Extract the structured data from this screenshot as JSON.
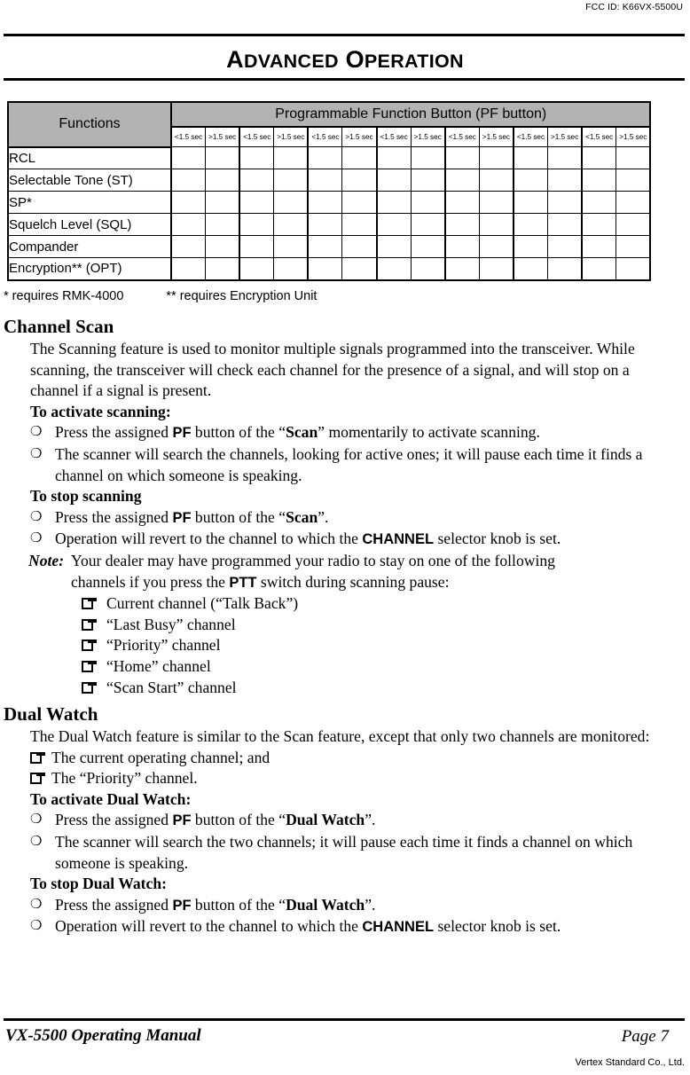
{
  "header": {
    "fcc_id": "FCC ID: K66VX-5500U"
  },
  "chapter": {
    "title_word1_cap": "A",
    "title_word1_rest": "DVANCED",
    "title_word2_cap": "O",
    "title_word2_rest": "PERATION",
    "title_plain": "ADVANCED OPERATION"
  },
  "table": {
    "col_functions_header": "Functions",
    "col_pf_header": "Programmable Function Button (PF button)",
    "sec_short": "<1.5 sec",
    "sec_long": ">1.5 sec",
    "pair_count": 7,
    "sub_headers": [
      "<1.5 sec",
      ">1.5 sec",
      "<1.5 sec",
      ">1.5 sec",
      "<1.5 sec",
      ">1.5 sec",
      "<1.5 sec",
      ">1.5 sec",
      "<1.5 sec",
      ">1.5 sec",
      "<1.5 sec",
      ">1.5 sec",
      "<1.5 sec",
      ">1.5 sec"
    ],
    "rows": [
      {
        "label": "RCL"
      },
      {
        "label": "Selectable Tone (ST)"
      },
      {
        "label": "SP*"
      },
      {
        "label": "Squelch Level (SQL)"
      },
      {
        "label": "Compander"
      },
      {
        "label": "Encryption** (OPT)"
      }
    ],
    "header_fill": "#b3b3b3"
  },
  "footnotes": {
    "note1": "* requires RMK-4000",
    "note2": "** requires Encryption Unit"
  },
  "channel_scan": {
    "heading": "Channel Scan",
    "intro": "The Scanning feature is used to monitor multiple signals programmed into the transceiver. While scanning, the transceiver will check each channel for the presence of a signal, and will stop on a channel if a signal is present.",
    "activate_heading": "To activate scanning:",
    "activate_b1_pre": "Press the assigned ",
    "activate_b1_pf": "PF",
    "activate_b1_mid": " button of the “",
    "activate_b1_scan": "Scan",
    "activate_b1_post": "” momentarily to activate scanning.",
    "activate_b2": "The scanner will search the channels, looking for active ones; it will pause each time it finds a channel on which someone is speaking.",
    "stop_heading": "To stop scanning",
    "stop_b1_pre": "Press the assigned ",
    "stop_b1_pf": "PF",
    "stop_b1_mid": " button of the “",
    "stop_b1_scan": "Scan",
    "stop_b1_post": "”.",
    "stop_b2_pre": "Operation will revert to the channel to which the ",
    "stop_b2_channel": "CHANNEL",
    "stop_b2_post": " selector knob is set.",
    "note_label": "Note:",
    "note_line1": "Your dealer may have programmed your radio to stay on one of the following",
    "note_line2_pre": "channels if you press the ",
    "note_line2_ptt": "PTT",
    "note_line2_post": " switch during scanning pause:",
    "note_items": [
      "Current channel (“Talk Back”)",
      "“Last Busy” channel",
      "“Priority” channel",
      "“Home” channel",
      "“Scan Start” channel"
    ]
  },
  "dual_watch": {
    "heading": "Dual Watch",
    "intro": "The Dual Watch feature is similar to the Scan feature, except that only two channels are monitored:",
    "items": [
      "The current operating channel; and",
      "The “Priority” channel."
    ],
    "activate_heading": "To activate Dual Watch:",
    "activate_b1_pre": "Press the assigned ",
    "activate_b1_pf": "PF",
    "activate_b1_mid": " button of the “",
    "activate_b1_name": "Dual Watch",
    "activate_b1_post": "”.",
    "activate_b2": "The scanner will search the two channels; it will pause each time it finds a channel on which someone is speaking.",
    "stop_heading": "To stop Dual Watch:",
    "stop_b1_pre": "Press the assigned ",
    "stop_b1_pf": "PF",
    "stop_b1_mid": " button of the “",
    "stop_b1_name": "Dual Watch",
    "stop_b1_post": "”.",
    "stop_b2_pre": "Operation will revert to the channel to which the ",
    "stop_b2_channel": "CHANNEL",
    "stop_b2_post": " selector knob is set."
  },
  "footer": {
    "manual_title": "VX-5500 Operating Manual",
    "page_number": "Page 7",
    "company": "Vertex Standard Co., Ltd."
  },
  "icons": {
    "bullet_circle": "❑",
    "bullet_open_circle": "○",
    "sub_bullet_square": "square-folded-corner-icon"
  }
}
